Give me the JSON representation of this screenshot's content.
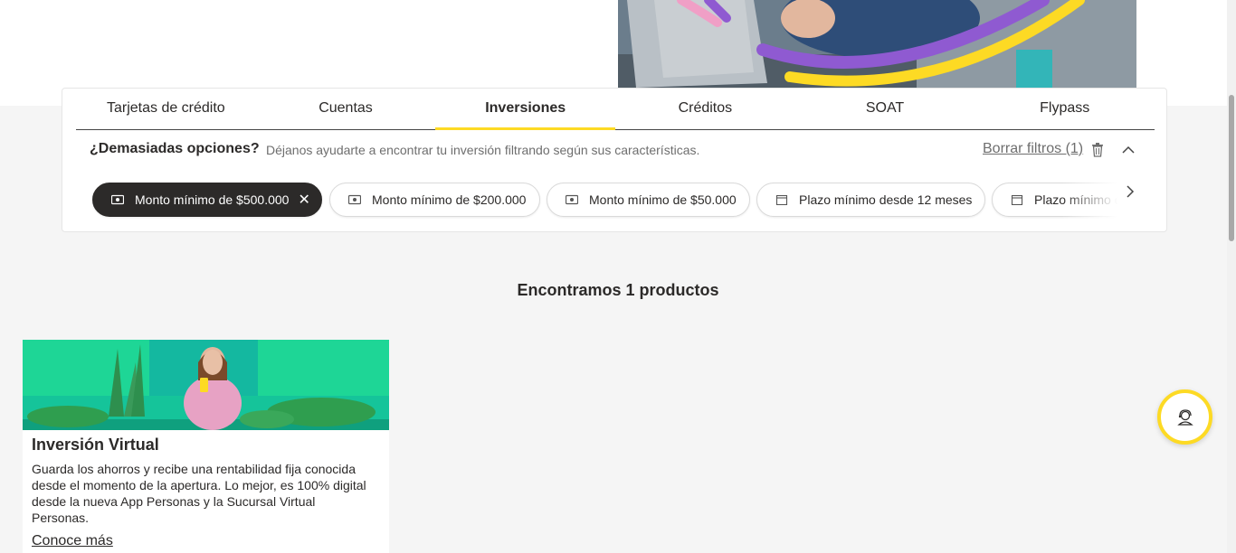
{
  "tabs": [
    {
      "label": "Tarjetas de crédito",
      "active": false
    },
    {
      "label": "Cuentas",
      "active": false
    },
    {
      "label": "Inversiones",
      "active": true
    },
    {
      "label": "Créditos",
      "active": false
    },
    {
      "label": "SOAT",
      "active": false
    },
    {
      "label": "Flypass",
      "active": false
    }
  ],
  "filters": {
    "title": "¿Demasiadas opciones?",
    "description": "Déjanos ayudarte a encontrar tu inversión filtrando según sus características.",
    "clear_label": "Borrar filtros (1)",
    "chips": [
      {
        "label": "Monto mínimo de $500.000",
        "icon": "money-icon",
        "active": true
      },
      {
        "label": "Monto mínimo de $200.000",
        "icon": "money-icon",
        "active": false
      },
      {
        "label": "Monto mínimo de $50.000",
        "icon": "money-icon",
        "active": false
      },
      {
        "label": "Plazo mínimo desde 12 meses",
        "icon": "calendar-icon",
        "active": false
      },
      {
        "label": "Plazo mínimo desde",
        "icon": "calendar-icon",
        "active": false
      }
    ]
  },
  "results": {
    "title": "Encontramos 1 productos"
  },
  "product": {
    "title": "Inversión Virtual",
    "description": "Guarda los ahorros y recibe una rentabilidad fija conocida desde el momento de la apertura. Lo mejor, es 100% digital desde la nueva App Personas y la Sucursal Virtual Personas.",
    "link_label": "Conoce más"
  },
  "colors": {
    "accent": "#fdda24",
    "dark": "#2c2a29",
    "background": "#f5f5f5"
  }
}
